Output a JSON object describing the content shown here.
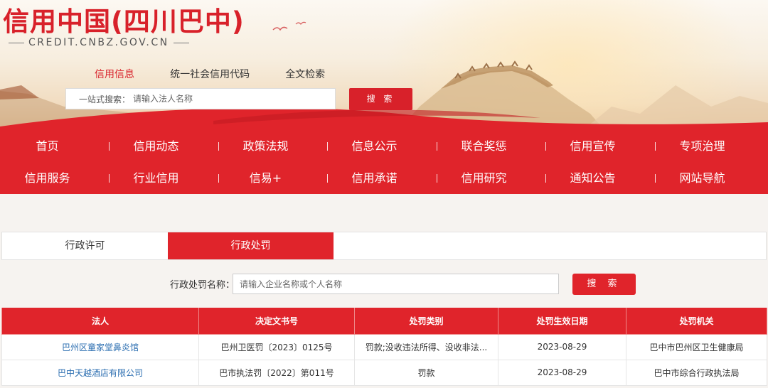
{
  "header": {
    "logo_cn": "信用中国(四川巴中)",
    "logo_en": "CREDIT.CNBZ.GOV.CN",
    "search_tabs": [
      "信用信息",
      "统一社会信用代码",
      "全文检索"
    ],
    "search_label": "一站式搜索：",
    "search_placeholder": "请输入法人名称",
    "search_button": "搜 索"
  },
  "nav": {
    "row1": [
      "首页",
      "信用动态",
      "政策法规",
      "信息公示",
      "联合奖惩",
      "信用宣传",
      "专项治理"
    ],
    "row2": [
      "信用服务",
      "行业信用",
      "信易+",
      "信用承诺",
      "信用研究",
      "通知公告",
      "网站导航"
    ]
  },
  "tabs": [
    "行政许可",
    "行政处罚"
  ],
  "query": {
    "label": "行政处罚名称：",
    "placeholder": "请输入企业名称或个人名称",
    "button": "搜 索"
  },
  "table": {
    "headers": [
      "法人",
      "决定文书号",
      "处罚类别",
      "处罚生效日期",
      "处罚机关"
    ],
    "rows": [
      [
        "巴州区童家堂鼻炎馆",
        "巴州卫医罚〔2023〕0125号",
        "罚款;没收违法所得、没收非法...",
        "2023-08-29",
        "巴中市巴州区卫生健康局"
      ],
      [
        "巴中天越酒店有限公司",
        "巴市执法罚〔2022〕第011号",
        "罚款",
        "2023-08-29",
        "巴中市综合行政执法局"
      ]
    ]
  },
  "colors": {
    "brand_red": "#e0242b",
    "link_blue": "#2a6db0"
  }
}
